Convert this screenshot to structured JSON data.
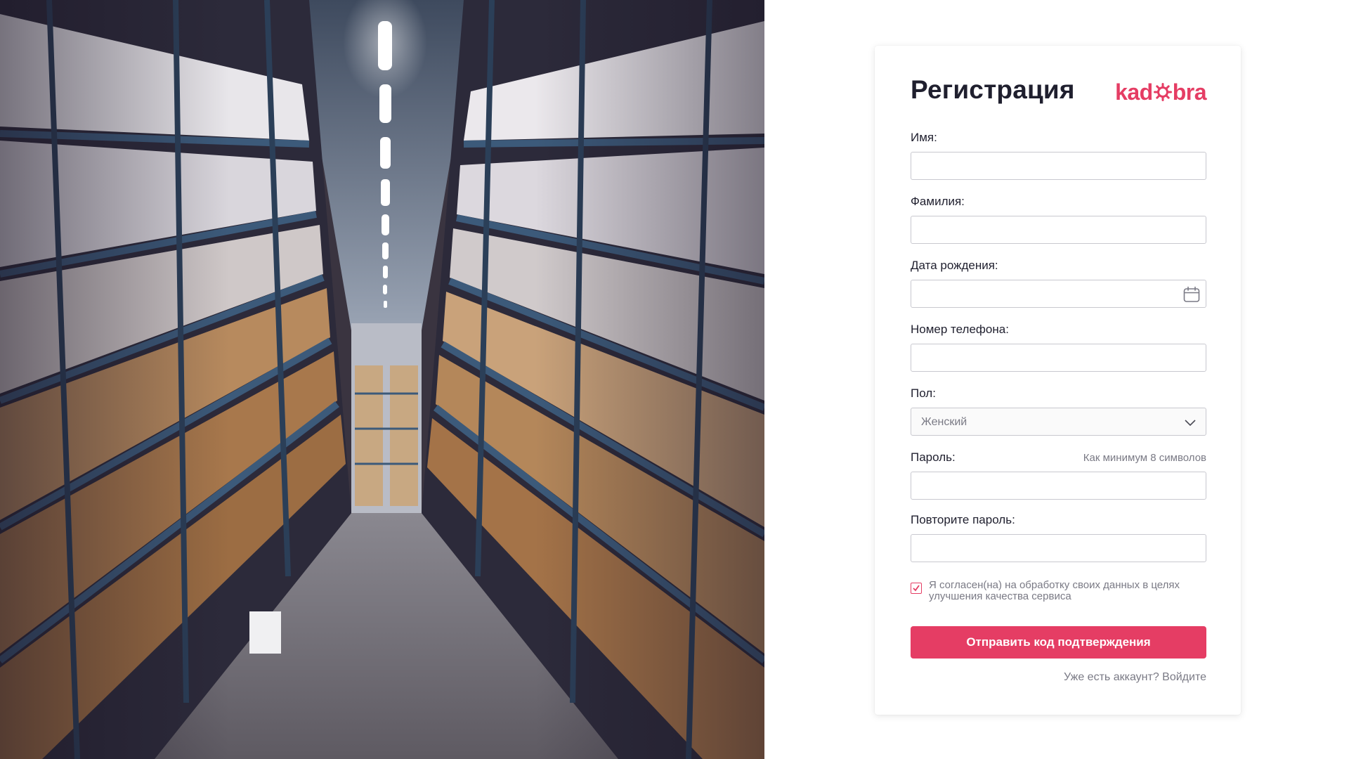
{
  "hero": {
    "image": "warehouse-aisle-photo"
  },
  "card": {
    "title": "Регистрация",
    "brand": {
      "left": "kad",
      "right": "bra",
      "star_icon": "brand-star-icon",
      "color": "#e53d64"
    }
  },
  "form": {
    "first_name": {
      "label": "Имя:",
      "value": "",
      "placeholder": ""
    },
    "last_name": {
      "label": "Фамилия:",
      "value": "",
      "placeholder": ""
    },
    "birth_date": {
      "label": "Дата рождения:",
      "value": "",
      "placeholder": "",
      "icon": "calendar-icon"
    },
    "phone": {
      "label": "Номер телефона:",
      "value": "",
      "placeholder": ""
    },
    "gender": {
      "label": "Пол:",
      "selected": "Женский",
      "icon": "chevron-down-icon"
    },
    "password": {
      "label": "Пароль:",
      "hint": "Как минимум 8 символов",
      "value": ""
    },
    "password_repeat": {
      "label": "Повторите пароль:",
      "value": ""
    },
    "consent": {
      "checked": true,
      "text": "Я согласен(на) на обработку своих данных в целях улучшения качества сервиса"
    },
    "submit_label": "Отправить код подтверждения",
    "login_link": "Уже есть аккаунт? Войдите"
  },
  "colors": {
    "accent": "#e53d64",
    "text": "#1f1f2e",
    "muted": "#7a7a85",
    "border": "#c8c8cf"
  }
}
